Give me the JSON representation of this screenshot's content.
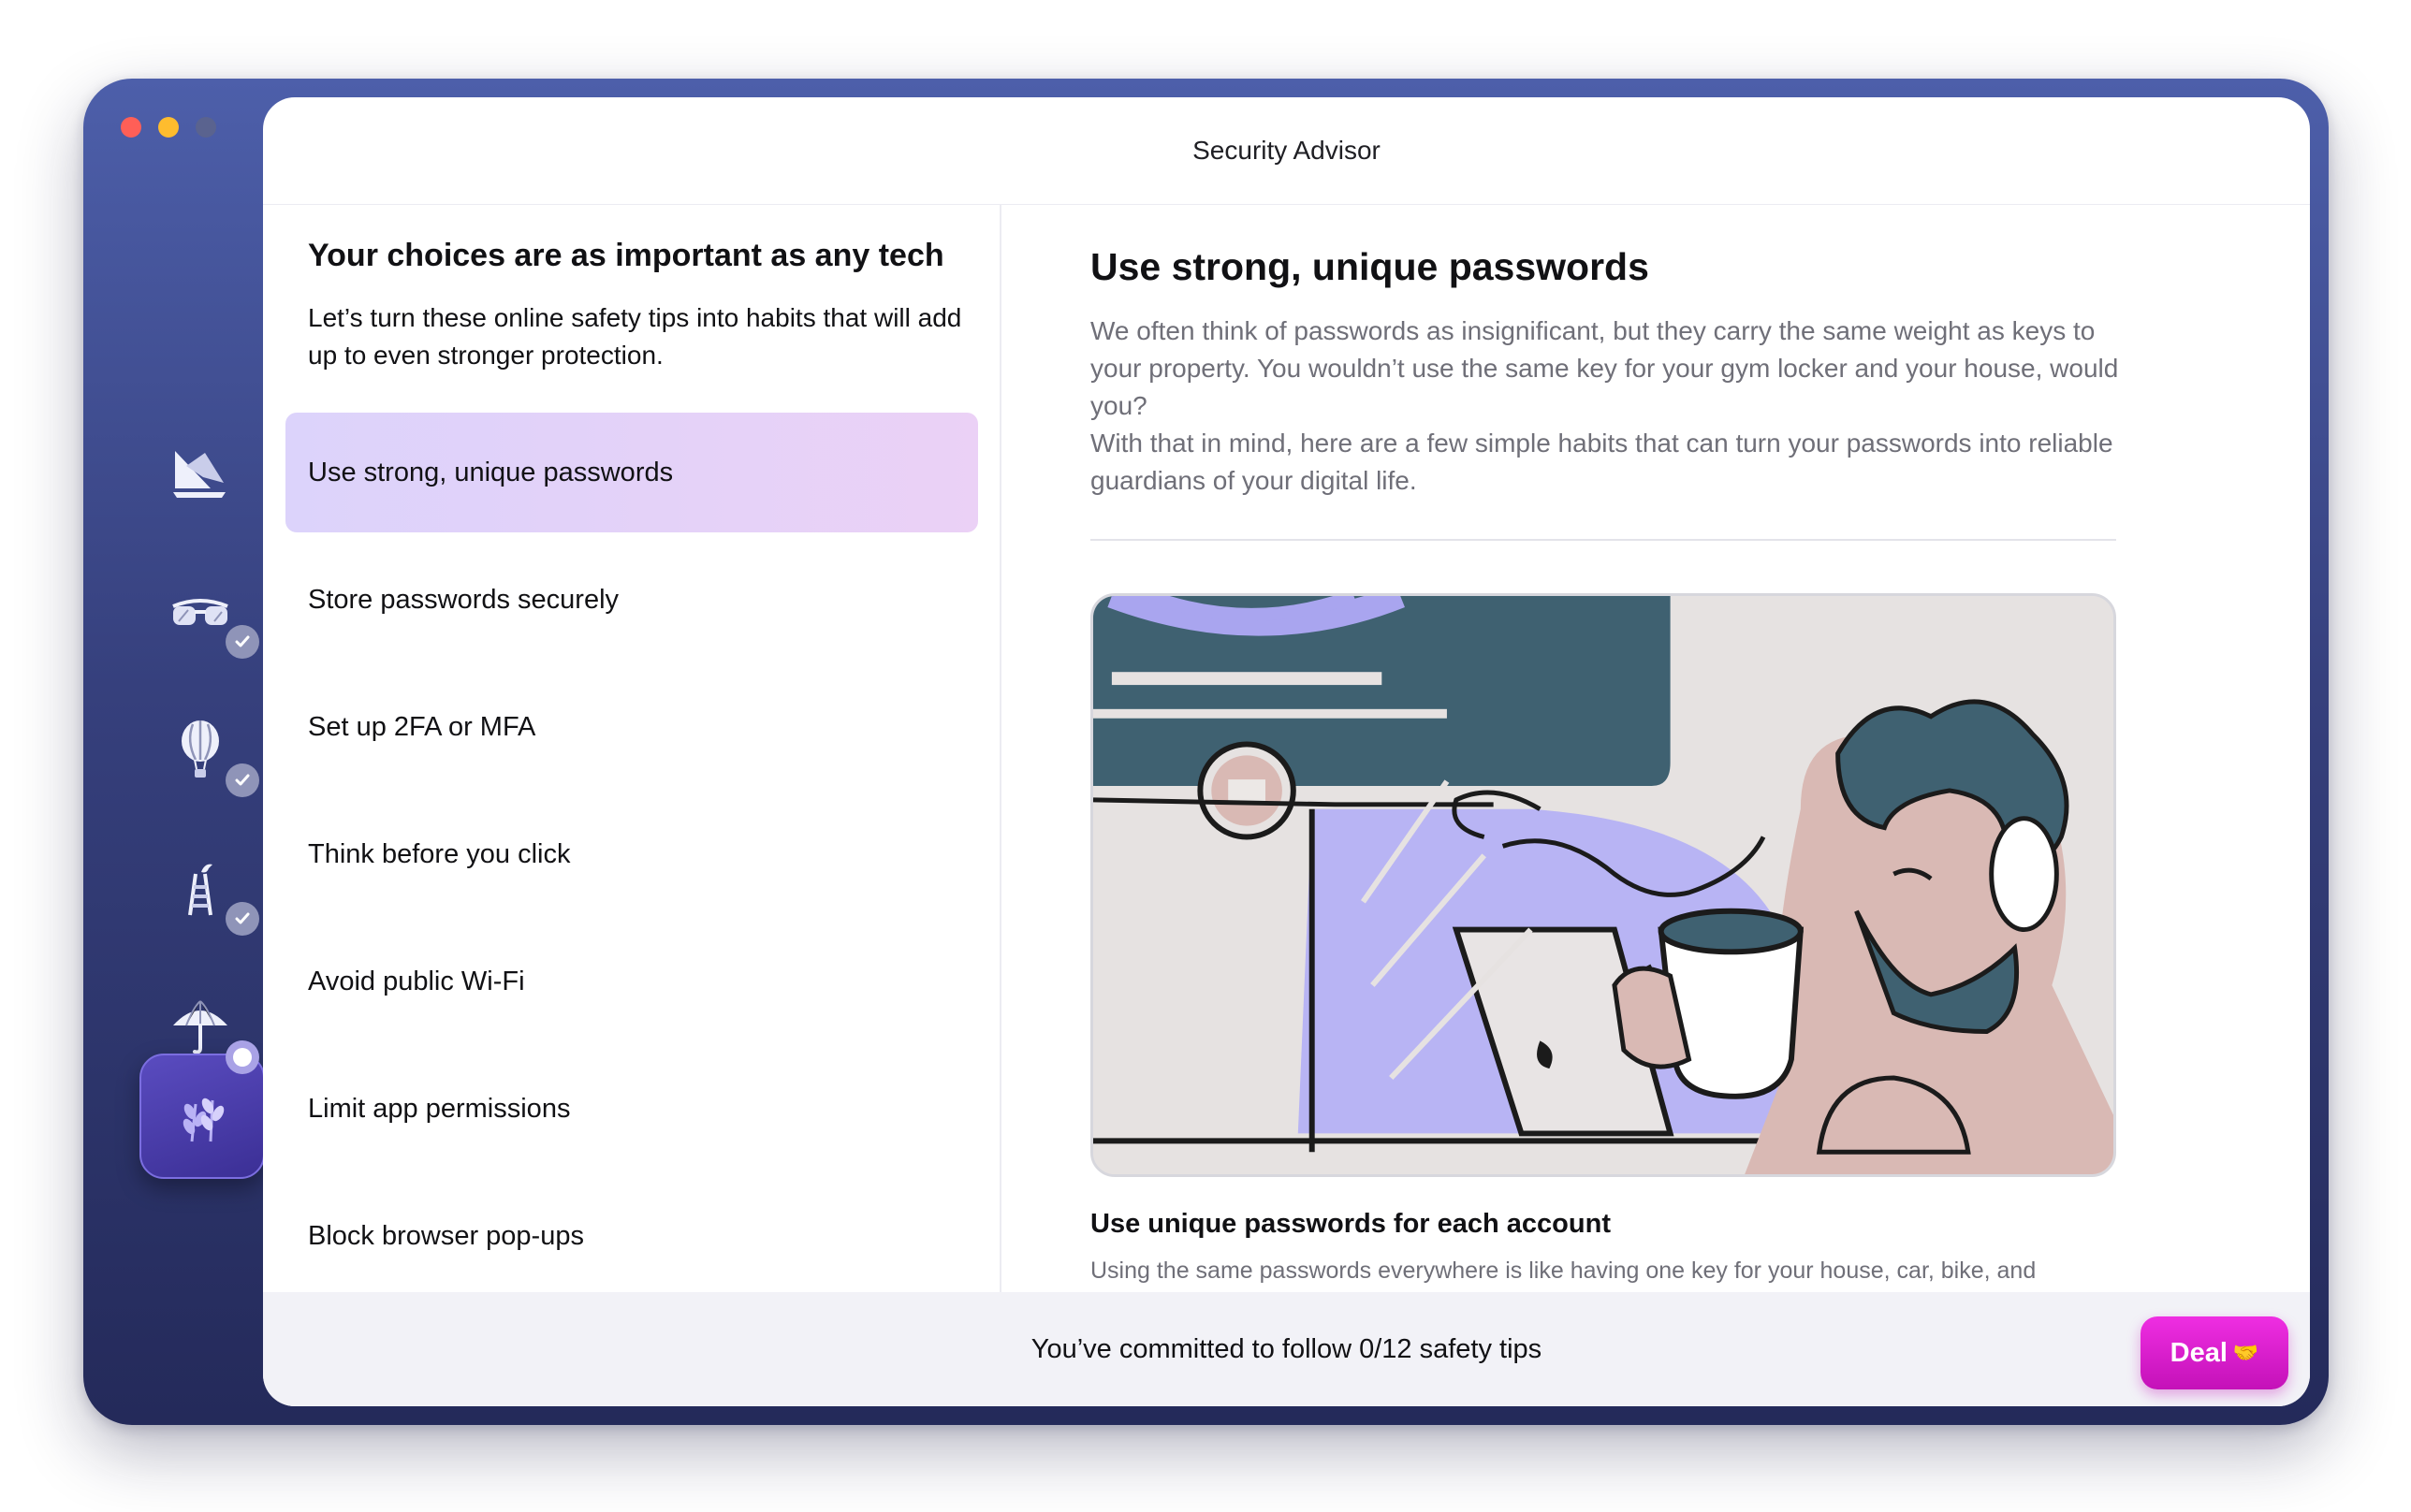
{
  "app": {
    "title": "Security Advisor",
    "accent_color": "#e520d6",
    "window_gradient": [
      "#4d5faa",
      "#242a5a"
    ]
  },
  "sidebar": {
    "items": [
      {
        "icon": "sailboat-icon",
        "status": "none",
        "active": false
      },
      {
        "icon": "sunglasses-icon",
        "status": "completed",
        "active": false
      },
      {
        "icon": "hot-air-balloon-icon",
        "status": "completed",
        "active": false
      },
      {
        "icon": "ladder-bird-icon",
        "status": "completed",
        "active": false
      },
      {
        "icon": "umbrella-icon",
        "status": "in-progress",
        "active": false
      },
      {
        "icon": "wheat-icon",
        "status": "current",
        "active": true
      }
    ]
  },
  "left_panel": {
    "heading": "Your choices are as important as any tech",
    "intro": "Let’s turn these online safety tips into habits that will add up to even stronger protection.",
    "tips": [
      {
        "label": "Use strong, unique passwords",
        "selected": true
      },
      {
        "label": "Store passwords securely",
        "selected": false
      },
      {
        "label": "Set up 2FA or MFA",
        "selected": false
      },
      {
        "label": "Think before you click",
        "selected": false
      },
      {
        "label": "Avoid public Wi-Fi",
        "selected": false
      },
      {
        "label": "Limit app permissions",
        "selected": false
      },
      {
        "label": "Block browser pop-ups",
        "selected": false
      }
    ]
  },
  "detail": {
    "title": "Use strong, unique passwords",
    "body": "We often think of passwords as insignificant, but they carry the same weight as keys to your property. You wouldn’t use the same key for your gym locker and your house, would you?\nWith that in mind, here are a few simple habits that can turn your passwords into reliable guardians of your digital life.",
    "illustration": "person-drinking-coffee-at-laptop-illustration",
    "section_title": "Use unique passwords for each account",
    "section_text": "Using the same passwords everywhere is like having one key for your house, car, bike, and"
  },
  "footer": {
    "status": "You’ve committed to follow 0/12 safety tips",
    "deal_label": "Deal",
    "deal_emoji": "🤝"
  }
}
